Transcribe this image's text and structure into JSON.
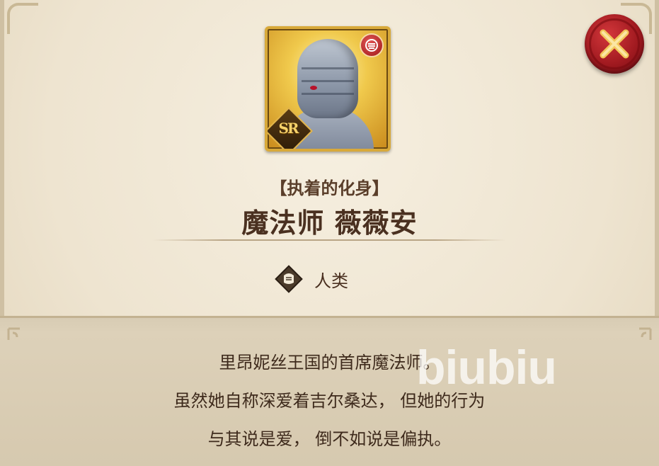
{
  "portrait": {
    "rarity": "SR",
    "attribute_icon": "fist-attribute-icon",
    "colors": {
      "frame": "#d8a93a",
      "attribute": "#c02a2a"
    }
  },
  "character": {
    "subtitle": "【执着的化身】",
    "name": "魔法师 薇薇安"
  },
  "race": {
    "icon": "race-human-icon",
    "label": "人类"
  },
  "description": {
    "lines": [
      "里昂妮丝王国的首席魔法师。",
      "虽然她自称深爱着吉尔桑达，  但她的行为",
      "与其说是爱，  倒不如说是偏执。"
    ]
  },
  "watermark": "biubiu",
  "close_button": {
    "icon": "close-icon",
    "color": "#b3202a"
  }
}
